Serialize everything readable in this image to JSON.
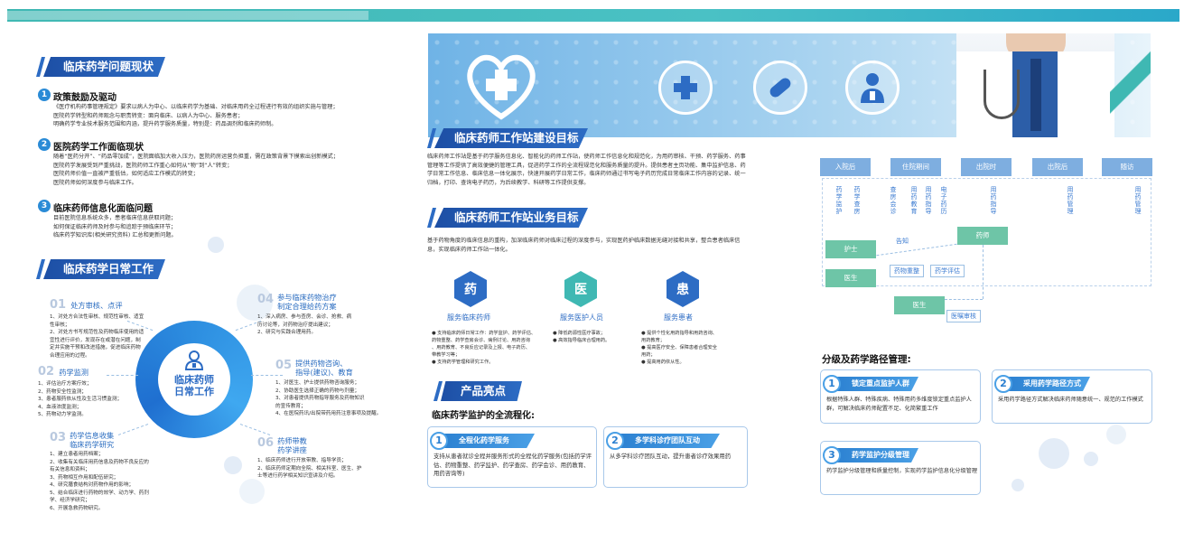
{
  "left": {
    "problems_title": "临床药学问题现状",
    "problems": [
      {
        "num": "1",
        "title": "政策鼓励及驱动",
        "lines": [
          "《医疗机构药事管理规定》要求以病人为中心、以临床药学为基础、对临床用药全过程进行有效的组织实施与管理；",
          "医院药学转型和药师观念与职责转变：面向临床、以病人为中心、服务患者；",
          "明确药学专业技术服务范围和内涵，提升药学服务质量，特别是：药品调剂和临床药师制。"
        ]
      },
      {
        "num": "2",
        "title": "医院药学工作面临现状",
        "lines": [
          "随着“医药分开”、“药品零加成”，医院面临加大收入压力，医院药房运营负担重，需在政策背景下摸索出创新模式；",
          "医院药学发展受到严重挑战，医院药师工作重心如何从“物”到“人”转变；",
          "医院药师价值一直被严重低估，如何适应工作模式的转变；",
          "医院药师如何深度参与临床工作。"
        ]
      },
      {
        "num": "3",
        "title": "临床药师信息化面临问题",
        "lines": [
          "目前医院信息系统众多，患者临床信息获取问题；",
          "如何保证临床药师及时参与和追踪于预临床环节；",
          "临床药学知识库(相关研究资料) 汇总和更新问题。"
        ]
      }
    ],
    "daily_title": "临床药学日常工作",
    "center_line1": "临床药师",
    "center_line2": "日常工作",
    "items": [
      {
        "num": "01",
        "title": [
          "处方审核、点评"
        ],
        "lines": [
          "1、对处方合法性审核、规范性审核、适宜",
          "性审核；",
          "2、对处方书写规范性及药物临床使用的适",
          "宜性进行评价，发现存在或潜在问题，制",
          "定并实施干预和改进措施，促进临床药物",
          "合理应用的过程。"
        ]
      },
      {
        "num": "02",
        "title": [
          "药学监测"
        ],
        "lines": [
          "1、评估治疗方案疗效；",
          "2、药物安全性监测；",
          "3、患者服药依从性及生活习惯监测；",
          "4、血液浓度监测；",
          "5、药物动力学监测。"
        ]
      },
      {
        "num": "03",
        "title": [
          "药学信息收集",
          "临床药学研究"
        ],
        "lines": [
          "1、建立患者用药档案；",
          "2、收集有关临床用药信息及药物不良反应的",
          "有关信息和资料；",
          "3、药物相互作用和配伍研究；",
          "4、研究膳食结构对药物作用的影响；",
          "5、结合临床进行药物的效学、动力学、药剂",
          "学、经济学研究；",
          "6、开展急救药物研究。"
        ]
      },
      {
        "num": "04",
        "title": [
          "参与临床药物治疗",
          "制定合理给药方案"
        ],
        "lines": [
          "1、深入病房、参与查房、会诊、抢救、病",
          "历讨论等，对药物治疗提出建议；",
          "2、研究与实践合理用药。"
        ]
      },
      {
        "num": "05",
        "title": [
          "提供药物咨询、",
          "指导(建议)、教育"
        ],
        "lines": [
          "1、对医生、护士提供药物咨询服务；",
          "2、协助医生选择正确的药物与剂量；",
          "3、对患者提供药物指导服务及药物知识",
          "的宣传教育；",
          "4、在医院药讯/出院带药用药注意事项及提醒。"
        ]
      },
      {
        "num": "06",
        "title": [
          "药师带教",
          "药学讲座"
        ],
        "lines": [
          "1、临床药师进行开放带教、指导学员；",
          "2、临床药师定期向全院、相关科室、医生、护",
          "士等进行药学相关知识宣讲及介绍。"
        ]
      }
    ]
  },
  "middle": {
    "goal_title": "临床药师工作站建设目标",
    "goal_text": "临床药师工作站是基于药学服务信息化、智能化的药师工作站，使药师工作信息化和规范化，为用药审核、干预、药学服务、药事管理等工作提供了高效便捷的管理工具，促进药学工作的全流程规范化和服务质量的提升。提供患者主页功能、集中监护信息、药学日常工作信息、临床信息一体化展示，快速开展药学日常工作，临床药师通过书写电子药历完成日常临床工作内容的记录、统一归档，打印、查询电子药历，为后续教学、科研等工作提供支撑。",
    "biz_title": "临床药师工作站业务目标",
    "biz_text": "基于药物角度的临床信息的重构，加深临床药师对临床过程的深度参与，实现医药护临床数据无缝对接和共享，整合患者临床信息，实现临床药师工作站一体化。",
    "hex": [
      {
        "icon": "药",
        "title": "服务临床药师",
        "lines": [
          "● 支持临床药师日常工作：药学监护、药学评估、",
          "药物重整、药学查房会诊、病例讨论、用药咨询",
          "、用药教育、不良反应记录及上报、电子药历、",
          "带教学习等；",
          "● 支持药学管理和研究工作。"
        ]
      },
      {
        "icon": "医",
        "title": "服务医护人员",
        "lines": [
          "● 降低药源性医疗事故；",
          "● 高效指导临床合理用药。"
        ]
      },
      {
        "icon": "患",
        "title": "服务患者",
        "lines": [
          "● 提供个性化用药指导和用药咨询、",
          "用药教育；",
          "● 提高医疗安全、保障患者合理安全",
          "用药；",
          "● 提高用药依从性。"
        ]
      }
    ],
    "highlight_title": "产品亮点",
    "highlight_sub": "临床药学监护的全流程化:",
    "cards": [
      {
        "num": "1",
        "title": "全程化药学服务",
        "text": "支持从患者就诊全程并服务形式的全程化药学服务(包括药学评估、药物重整、药学监护、药学查房、药学会诊、用药教育、用药咨询等)"
      },
      {
        "num": "2",
        "title": "多学科诊疗团队互动",
        "text": "从多学科诊疗团队互动，提升患者诊疗效果用药"
      }
    ]
  },
  "right": {
    "flow_top": [
      "入院后",
      "住院期间",
      "出院时",
      "出院后",
      "随访"
    ],
    "vlabels": [
      "药学监护",
      "药学查房",
      "查房会诊",
      "用药教育",
      "用药指导",
      "电子药历",
      "用药指导",
      "用药管理",
      "用药管理"
    ],
    "nurse": "护士",
    "inform": "告知",
    "pharmacist": "药师",
    "doctor1": "医生",
    "tag1": "药物重整",
    "tag2": "药学评估",
    "doctor2": "医生",
    "tag3": "医嘱审核",
    "path_title": "分级及药学路径管理:",
    "cards": [
      {
        "num": "1",
        "title": "锁定重点监护人群",
        "text": "根据特殊人群、特殊疾病、特殊用药多维度锁定重点监护人群，可解决临床药师配置不足、化简繁重工作"
      },
      {
        "num": "2",
        "title": "采用药学路径方式",
        "text": "采用药学路径方式解决临床药师随意统一、规范的工作模式"
      },
      {
        "num": "3",
        "title": "药学监护分级管理",
        "text": "药学监护分级管理和质量控制，实现药学监护信息化分级管理"
      }
    ]
  },
  "colors": {
    "primary": "#2d6cc4",
    "teal": "#3fb8b3",
    "green": "#6ec5a7",
    "lightblue": "#7eaee0"
  },
  "icons": [
    "heart-cross-icon",
    "cross-icon",
    "pill-icon",
    "doctor-icon",
    "pharmacist-icon"
  ]
}
